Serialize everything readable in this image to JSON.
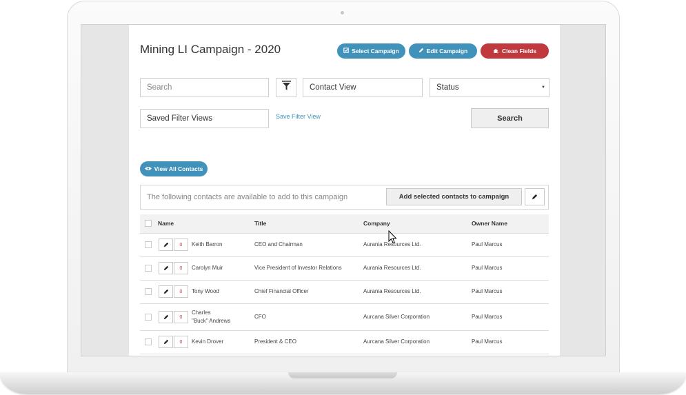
{
  "page": {
    "title": "Mining LI Campaign - 2020"
  },
  "header_buttons": {
    "select_campaign": "Select Campaign",
    "edit_campaign": "Edit Campaign",
    "clean_fields": "Clean Fields"
  },
  "filters": {
    "search_placeholder": "Search",
    "contact_view": "Contact View",
    "status": "Status",
    "saved_filter_views": "Saved Filter Views",
    "save_filter_view_link": "Save Filter View",
    "search_button": "Search"
  },
  "view_all_contacts": "View All Contacts",
  "info_bar": {
    "text": "The following contacts are available to add to this campaign",
    "add_button": "Add selected contacts to campaign"
  },
  "table": {
    "columns": [
      "Name",
      "Title",
      "Company",
      "Owner Name"
    ],
    "rows": [
      {
        "name": "Keith Barron",
        "name2": "",
        "count": "0",
        "title": "CEO and Chairman",
        "company": "Aurania Resources Ltd.",
        "owner": "Paul Marcus"
      },
      {
        "name": "Carolyn Muir",
        "name2": "",
        "count": "0",
        "title": "Vice President of Investor Relations",
        "company": "Aurania Resources Ltd.",
        "owner": "Paul Marcus"
      },
      {
        "name": "Tony Wood",
        "name2": "",
        "count": "0",
        "title": "Chief Financial Officer",
        "company": "Aurania Resources Ltd.",
        "owner": "Paul Marcus"
      },
      {
        "name": "Charles",
        "name2": "\"Buck\" Andrews",
        "count": "0",
        "title": "CFO",
        "company": "Aurcana Silver Corporation",
        "owner": "Paul Marcus"
      },
      {
        "name": "Kevin Drover",
        "name2": "",
        "count": "0",
        "title": "President & CEO",
        "company": "Aurcana Silver Corporation",
        "owner": "Paul Marcus"
      }
    ]
  },
  "colors": {
    "accent_blue": "#4192bb",
    "danger_red": "#c0393e"
  },
  "icons": {
    "select_campaign": "check-square-icon",
    "edit_campaign": "pencil-icon",
    "clean_fields": "eraser-icon",
    "filter": "funnel-icon",
    "view_all": "eye-icon",
    "row_edit": "pencil-icon"
  }
}
